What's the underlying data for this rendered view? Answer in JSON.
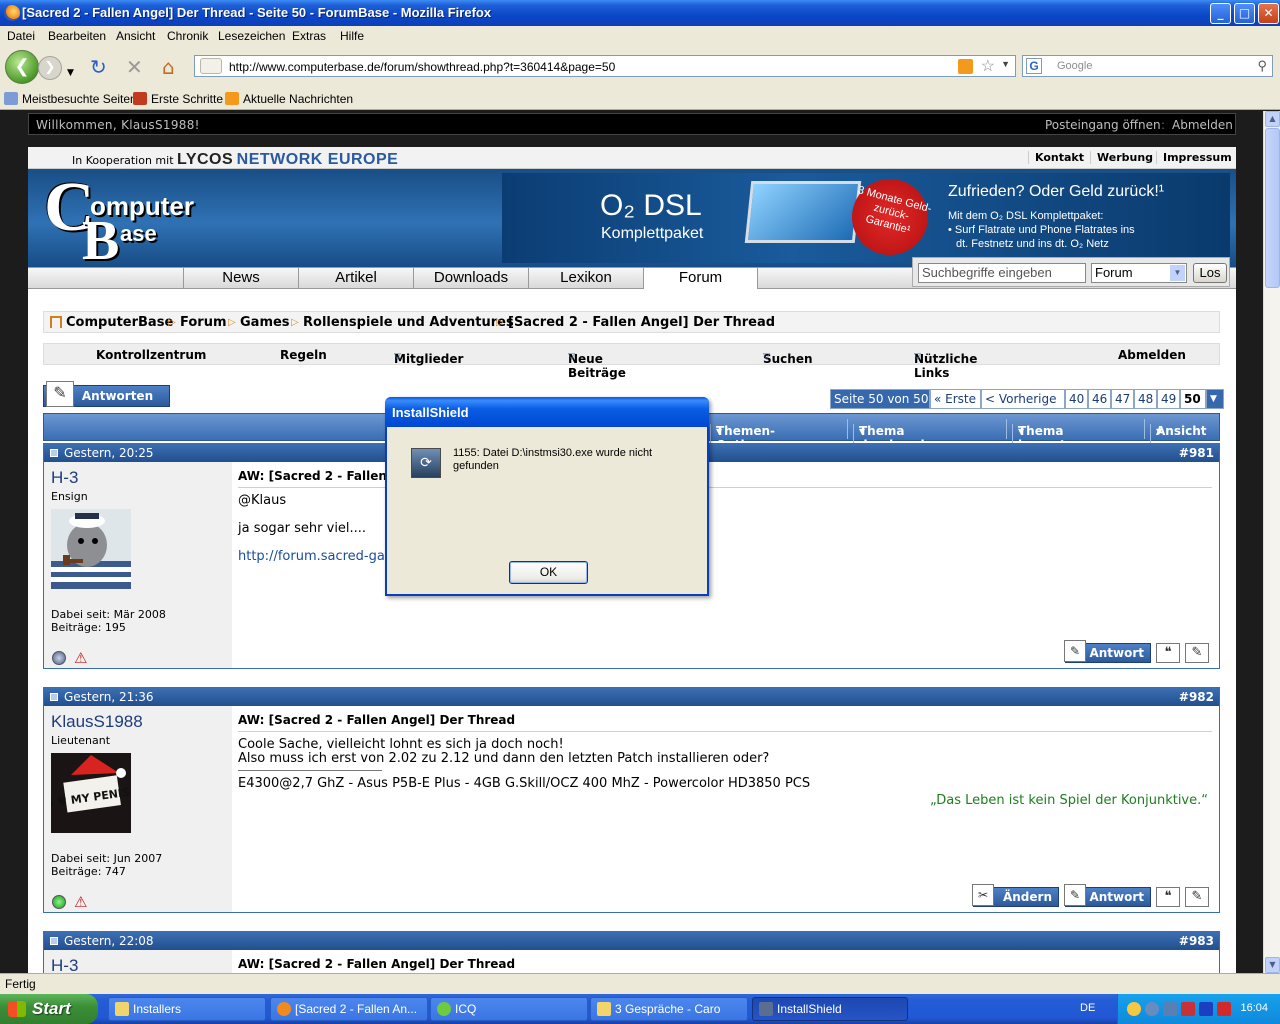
{
  "window": {
    "title": "[Sacred 2 - Fallen Angel] Der Thread - Seite 50 - ForumBase - Mozilla Firefox",
    "min": "_",
    "max": "□",
    "close": "✕"
  },
  "menu": [
    "Datei",
    "Bearbeiten",
    "Ansicht",
    "Chronik",
    "Lesezeichen",
    "Extras",
    "Hilfe"
  ],
  "address": {
    "url": "http://www.computerbase.de/forum/showthread.php?t=360414&page=50",
    "search_placeholder": "Google"
  },
  "bookmarks": [
    "Meistbesuchte Seiten",
    "Erste Schritte",
    "Aktuelle Nachrichten"
  ],
  "toprow": {
    "welcome": "Willkommen, KlausS1988!",
    "inbox": "Posteingang öffnen",
    "logout": "Abmelden"
  },
  "coop": {
    "prefix": "In Kooperation mit",
    "lycos": "LYCOS",
    "network": "NETWORK EUROPE",
    "links": [
      "Kontakt",
      "Werbung",
      "Impressum"
    ]
  },
  "logo": {
    "c": "C",
    "omputer": "omputer",
    "b": "B",
    "ase": "ase"
  },
  "ad": {
    "o2": "O₂ DSL",
    "kp": "Komplettpaket",
    "badge": "3 Monate Geld-zurück-Garantie¹",
    "claim": "Zufrieden? Oder Geld zurück!¹",
    "sub1": "Mit dem O₂ DSL Komplettpaket:",
    "sub2": "• Surf Flatrate und Phone Flatrates ins",
    "sub3": "dt. Festnetz und ins dt. O₂ Netz"
  },
  "nav": [
    "News",
    "Artikel",
    "Downloads",
    "Lexikon",
    "Forum"
  ],
  "sitesearch": {
    "placeholder": "Suchbegriffe eingeben",
    "scope": "Forum",
    "button": "Los"
  },
  "breadcrumb": [
    "ComputerBase",
    "Forum",
    "Games",
    "Rollenspiele und Adventures",
    "[Sacred 2 - Fallen Angel] Der Thread"
  ],
  "controlbar": [
    "Kontrollzentrum",
    "Regeln",
    "Mitglieder",
    "Neue Beiträge",
    "Suchen",
    "Nützliche Links",
    "Abmelden"
  ],
  "reply_button": "Antworten",
  "pager": {
    "info": "Seite 50 von 50",
    "first": "« Erste",
    "prev": "< Vorherige",
    "pages": [
      "40",
      "46",
      "47",
      "48",
      "49"
    ],
    "current": "50"
  },
  "threadbar": [
    "Themen-Optionen",
    "Thema durchsuchen",
    "Thema bewerten",
    "Ansicht"
  ],
  "posts": [
    {
      "date": "Gestern, 20:25",
      "number": "#981",
      "user": "H-3",
      "rank": "Ensign",
      "joined": "Dabei seit: Mär 2008",
      "count": "Beiträge: 195",
      "title": "AW: [Sacred 2 - Fallen Angel] Der Thread",
      "lines": [
        "@Klaus",
        "ja sogar sehr viel....",
        "http://forum.sacred-game.com/"
      ],
      "buttons": [
        "Antwort"
      ]
    },
    {
      "date": "Gestern, 21:36",
      "number": "#982",
      "user": "KlausS1988",
      "rank": "Lieutenant",
      "avatar_text": "I ♥ MY PENIS",
      "joined": "Dabei seit: Jun 2007",
      "count": "Beiträge: 747",
      "title": "AW: [Sacred 2 - Fallen Angel] Der Thread",
      "lines": [
        "Coole Sache, vielleicht lohnt es sich ja doch noch!",
        "Also muss ich erst von 2.02 zu 2.12 und dann den letzten Patch installieren oder?"
      ],
      "signature": "E4300@2,7 GhZ - Asus P5B-E Plus - 4GB G.Skill/OCZ 400 MhZ - Powercolor HD3850 PCS",
      "quote": "„Das Leben ist kein Spiel der Konjunktive.“",
      "buttons": [
        "Ändern",
        "Antwort"
      ]
    },
    {
      "date": "Gestern, 22:08",
      "number": "#983",
      "user": "H-3",
      "title": "AW: [Sacred 2 - Fallen Angel] Der Thread"
    }
  ],
  "dialog": {
    "title": "InstallShield",
    "message": "1155: Datei D:\\instmsi30.exe wurde nicht gefunden",
    "ok": "OK"
  },
  "status": "Fertig",
  "taskbar": {
    "start": "Start",
    "tasks": [
      "Installers",
      "[Sacred 2 - Fallen An...",
      "ICQ",
      "3 Gespräche - Caro",
      "InstallShield"
    ],
    "lang": "DE",
    "clock": "16:04"
  }
}
